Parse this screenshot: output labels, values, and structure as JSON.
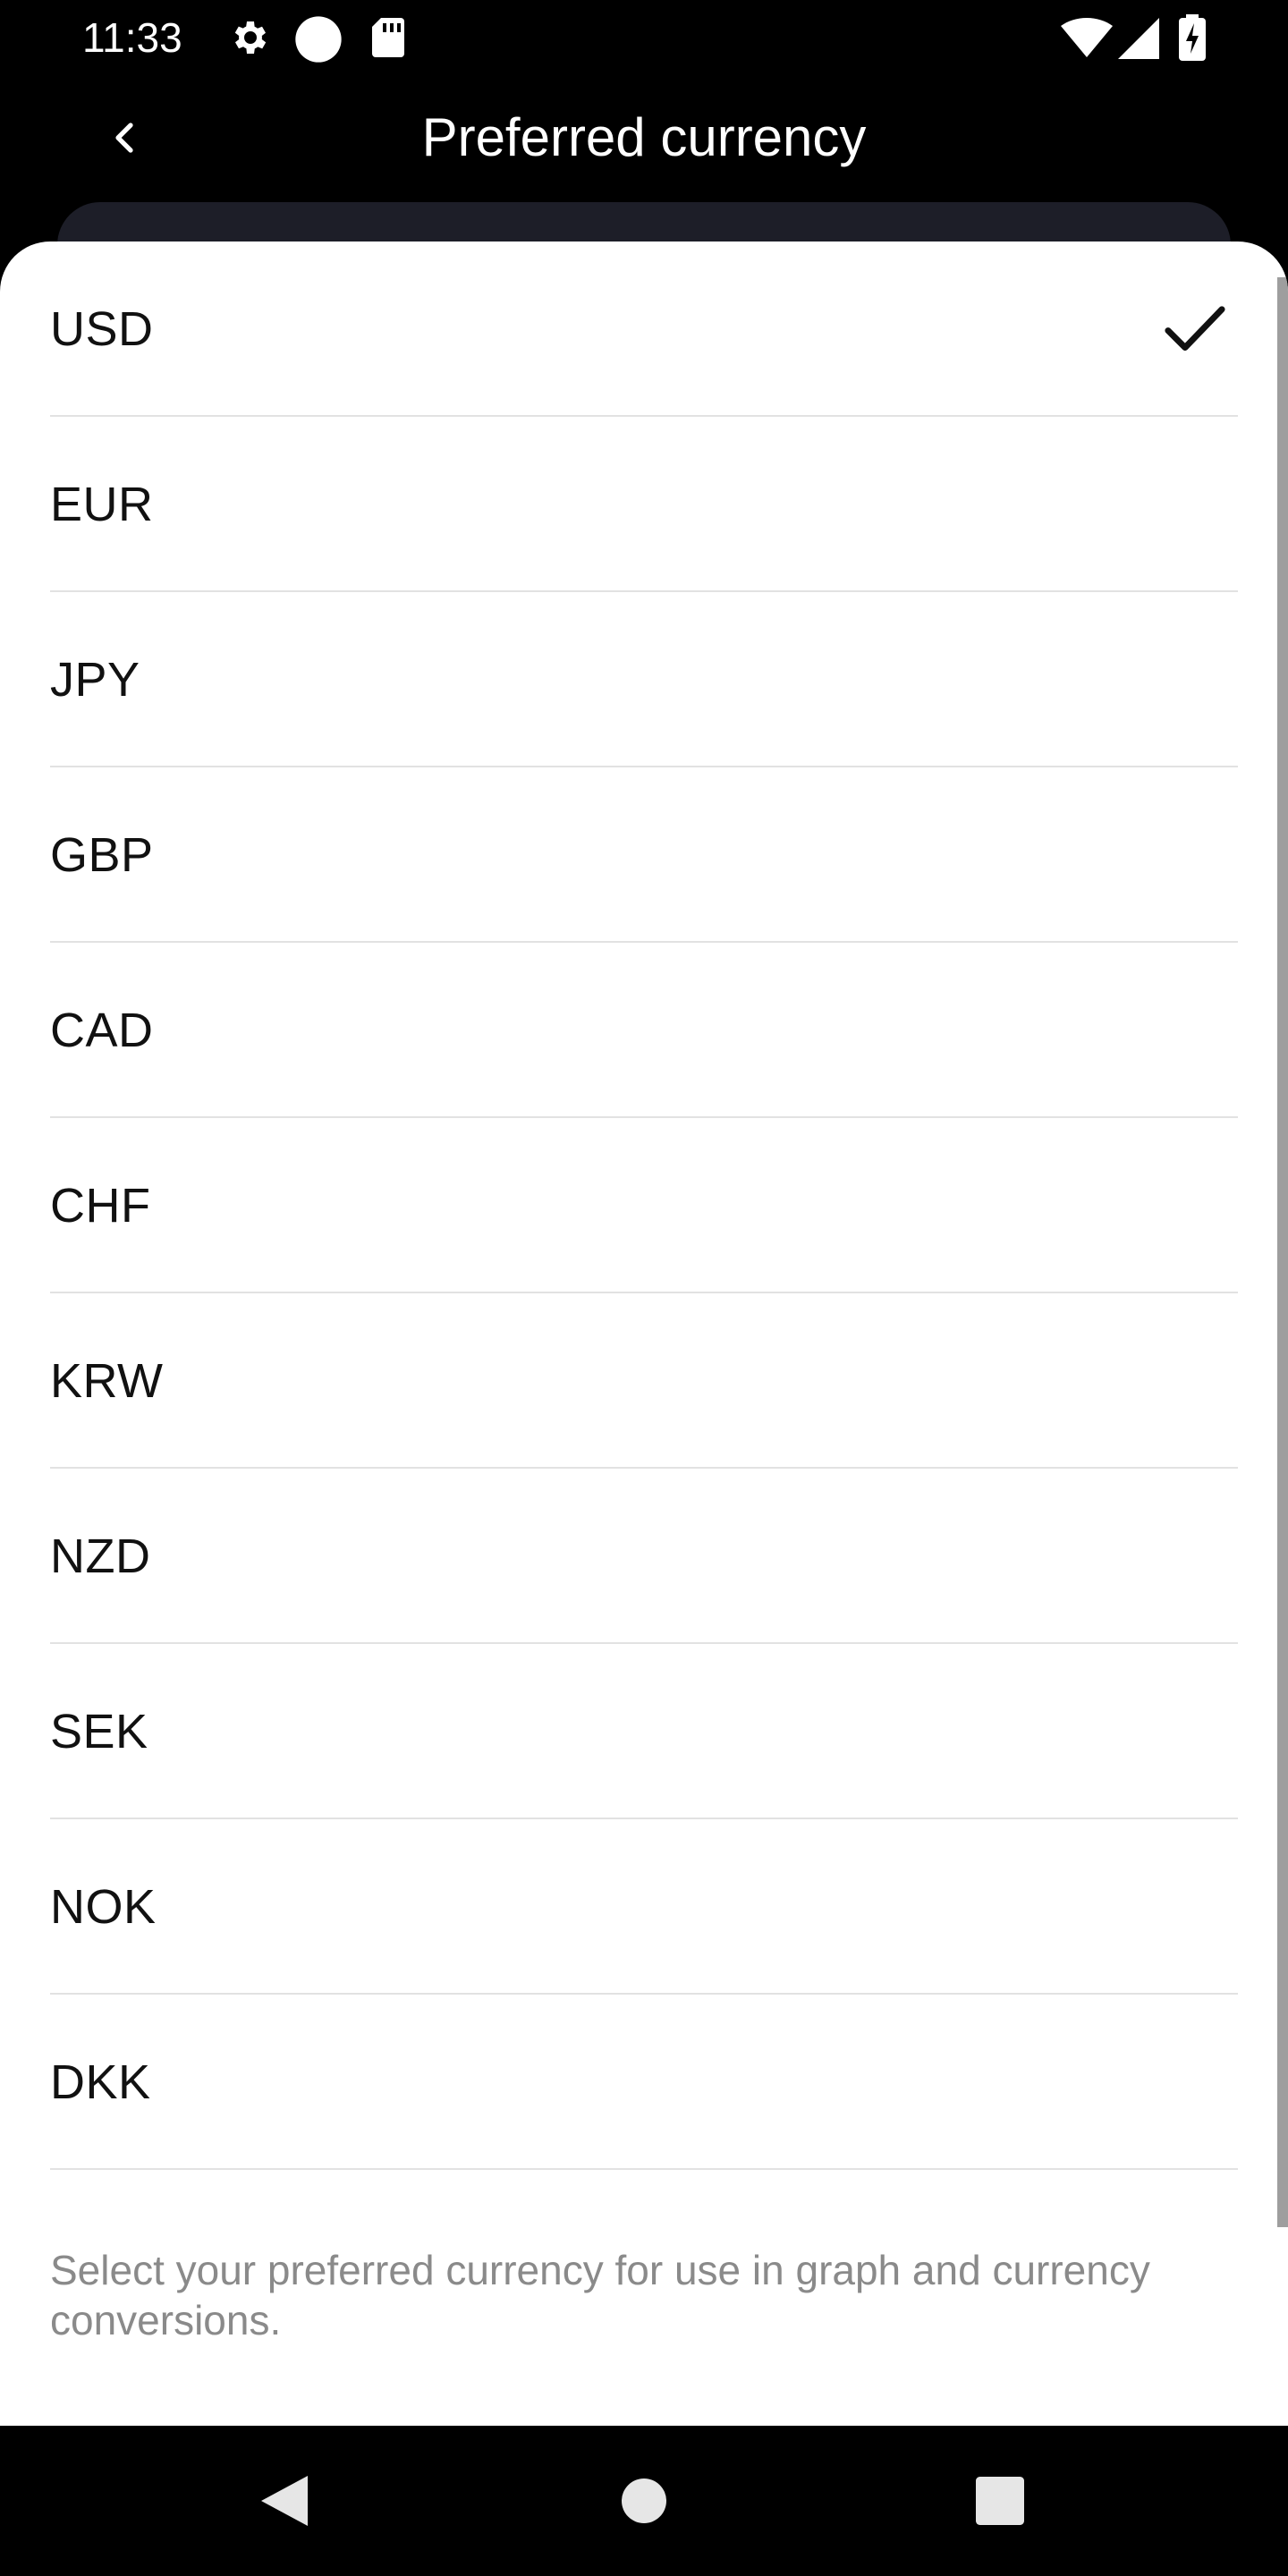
{
  "status_bar": {
    "time": "11:33",
    "icons": [
      "gear-icon",
      "circle-icon",
      "sd-card-icon",
      "wifi-icon",
      "signal-icon",
      "battery-charging-icon"
    ]
  },
  "app_bar": {
    "title": "Preferred currency",
    "back_icon": "chevron-left-icon"
  },
  "currency_list": {
    "selected": "USD",
    "items": [
      {
        "label": "USD",
        "selected": true
      },
      {
        "label": "EUR",
        "selected": false
      },
      {
        "label": "JPY",
        "selected": false
      },
      {
        "label": "GBP",
        "selected": false
      },
      {
        "label": "CAD",
        "selected": false
      },
      {
        "label": "CHF",
        "selected": false
      },
      {
        "label": "KRW",
        "selected": false
      },
      {
        "label": "NZD",
        "selected": false
      },
      {
        "label": "SEK",
        "selected": false
      },
      {
        "label": "NOK",
        "selected": false
      },
      {
        "label": "DKK",
        "selected": false
      }
    ]
  },
  "helper_text": "Select your preferred currency for use in graph and currency conversions.",
  "nav_bar": {
    "icons": [
      "back-triangle-icon",
      "home-circle-icon",
      "recents-square-icon"
    ]
  },
  "colors": {
    "background": "#000000",
    "sheet": "#ffffff",
    "under_card": "#1d1e28",
    "divider": "#e2e2e2",
    "helper_text": "#8a8a8a"
  }
}
